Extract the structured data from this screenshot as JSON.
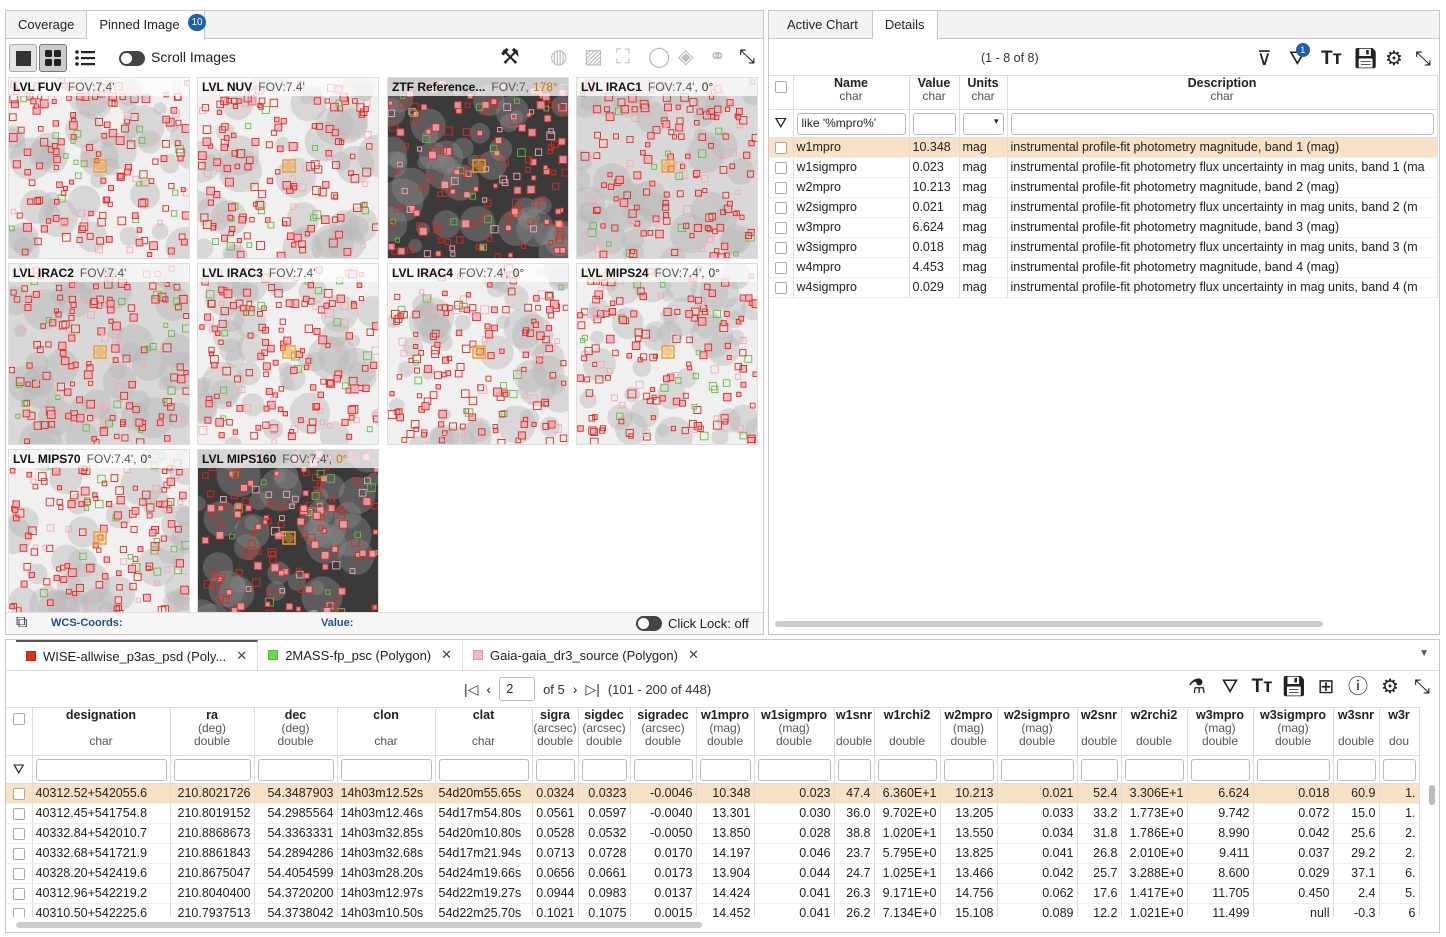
{
  "left_panel": {
    "tabs": [
      {
        "label": "Coverage"
      },
      {
        "label": "Pinned Image",
        "badge": "10"
      }
    ],
    "scroll_label": "Scroll Images",
    "tiles": [
      {
        "name": "LVL FUV",
        "fov": "FOV:7.4'",
        "rot": "",
        "bg": "light"
      },
      {
        "name": "LVL NUV",
        "fov": "FOV:7.4'",
        "rot": "",
        "bg": "light"
      },
      {
        "name": "ZTF Reference...",
        "fov": "FOV:7,",
        "rot": "178°",
        "bg": "dark"
      },
      {
        "name": "LVL IRAC1",
        "fov": "FOV:7.4',",
        "rot": "0°",
        "bg": "mid"
      },
      {
        "name": "LVL IRAC2",
        "fov": "FOV:7.4'",
        "rot": "",
        "bg": "mid"
      },
      {
        "name": "LVL IRAC3",
        "fov": "FOV:7.4'",
        "rot": "",
        "bg": "light"
      },
      {
        "name": "LVL IRAC4",
        "fov": "FOV:7.4',",
        "rot": "0°",
        "bg": "light"
      },
      {
        "name": "LVL MIPS24",
        "fov": "FOV:7.4',",
        "rot": "0°",
        "bg": "light"
      },
      {
        "name": "LVL MIPS70",
        "fov": "FOV:7.4',",
        "rot": "0°",
        "bg": "light"
      },
      {
        "name": "LVL MIPS160",
        "fov": "FOV:7.4',",
        "rot": "0°",
        "bg": "dark"
      }
    ],
    "status": {
      "wcs_label": "WCS-Coords:",
      "value_label": "Value:",
      "click_lock": "Click Lock: off"
    }
  },
  "right_panel": {
    "tabs": [
      {
        "label": "Active Chart"
      },
      {
        "label": "Details"
      }
    ],
    "count": "(1 - 8 of 8)",
    "filter_badge": "1",
    "columns": [
      {
        "name": "Name",
        "type": "char",
        "filter": "like '%mpro%'"
      },
      {
        "name": "Value",
        "type": "char",
        "filter": ""
      },
      {
        "name": "Units",
        "type": "char",
        "filter": ""
      },
      {
        "name": "Description",
        "type": "char",
        "filter": ""
      }
    ],
    "rows": [
      {
        "name": "w1mpro",
        "value": "10.348",
        "units": "mag",
        "desc": "instrumental profile-fit photometry magnitude, band 1 (mag)"
      },
      {
        "name": "w1sigmpro",
        "value": "0.023",
        "units": "mag",
        "desc": "instrumental profile-fit photometry flux uncertainty in mag units, band 1 (ma"
      },
      {
        "name": "w2mpro",
        "value": "10.213",
        "units": "mag",
        "desc": "instrumental profile-fit photometry magnitude, band 2 (mag)"
      },
      {
        "name": "w2sigmpro",
        "value": "0.021",
        "units": "mag",
        "desc": "instrumental profile-fit photometry flux uncertainty in mag units, band 2 (m"
      },
      {
        "name": "w3mpro",
        "value": "6.624",
        "units": "mag",
        "desc": "instrumental profile-fit photometry magnitude, band 3 (mag)"
      },
      {
        "name": "w3sigmpro",
        "value": "0.018",
        "units": "mag",
        "desc": "instrumental profile-fit photometry flux uncertainty in mag units, band 3 (m"
      },
      {
        "name": "w4mpro",
        "value": "4.453",
        "units": "mag",
        "desc": "instrumental profile-fit photometry magnitude, band 4 (mag)"
      },
      {
        "name": "w4sigmpro",
        "value": "0.029",
        "units": "mag",
        "desc": "instrumental profile-fit photometry flux uncertainty in mag units, band 4 (m"
      }
    ]
  },
  "bottom_panel": {
    "tabs": [
      {
        "label": "WISE-allwise_p3as_psd (Poly...",
        "color": "#e03020"
      },
      {
        "label": "2MASS-fp_psc (Polygon)",
        "color": "#66dd44"
      },
      {
        "label": "Gaia-gaia_dr3_source (Polygon)",
        "color": "#f4b8c4"
      }
    ],
    "pager": {
      "page": "2",
      "of": "of 5",
      "range": "(101 - 200 of 448)"
    },
    "columns": [
      {
        "name": "designation",
        "unit": "",
        "type": "char"
      },
      {
        "name": "ra",
        "unit": "(deg)",
        "type": "double"
      },
      {
        "name": "dec",
        "unit": "(deg)",
        "type": "double"
      },
      {
        "name": "clon",
        "unit": "",
        "type": "char"
      },
      {
        "name": "clat",
        "unit": "",
        "type": "char"
      },
      {
        "name": "sigra",
        "unit": "(arcsec)",
        "type": "double"
      },
      {
        "name": "sigdec",
        "unit": "(arcsec)",
        "type": "double"
      },
      {
        "name": "sigradec",
        "unit": "(arcsec)",
        "type": "double"
      },
      {
        "name": "w1mpro",
        "unit": "(mag)",
        "type": "double"
      },
      {
        "name": "w1sigmpro",
        "unit": "(mag)",
        "type": "double"
      },
      {
        "name": "w1snr",
        "unit": "",
        "type": "double"
      },
      {
        "name": "w1rchi2",
        "unit": "",
        "type": "double"
      },
      {
        "name": "w2mpro",
        "unit": "(mag)",
        "type": "double"
      },
      {
        "name": "w2sigmpro",
        "unit": "(mag)",
        "type": "double"
      },
      {
        "name": "w2snr",
        "unit": "",
        "type": "double"
      },
      {
        "name": "w2rchi2",
        "unit": "",
        "type": "double"
      },
      {
        "name": "w3mpro",
        "unit": "(mag)",
        "type": "double"
      },
      {
        "name": "w3sigmpro",
        "unit": "(mag)",
        "type": "double"
      },
      {
        "name": "w3snr",
        "unit": "",
        "type": "double"
      },
      {
        "name": "w3r",
        "unit": "",
        "type": "dou"
      }
    ],
    "rows": [
      [
        "40312.52+542055.6",
        "210.8021726",
        "54.3487903",
        "14h03m12.52s",
        "54d20m55.65s",
        "0.0324",
        "0.0323",
        "-0.0046",
        "10.348",
        "0.023",
        "47.4",
        "6.360E+1",
        "10.213",
        "0.021",
        "52.4",
        "3.306E+1",
        "6.624",
        "0.018",
        "60.9",
        "1."
      ],
      [
        "40312.45+541754.8",
        "210.8019152",
        "54.2985564",
        "14h03m12.46s",
        "54d17m54.80s",
        "0.0561",
        "0.0597",
        "-0.0040",
        "13.301",
        "0.030",
        "36.0",
        "9.702E+0",
        "13.205",
        "0.033",
        "33.2",
        "1.773E+0",
        "9.742",
        "0.072",
        "15.0",
        "1."
      ],
      [
        "40332.84+542010.7",
        "210.8868673",
        "54.3363331",
        "14h03m32.85s",
        "54d20m10.80s",
        "0.0528",
        "0.0532",
        "-0.0050",
        "13.850",
        "0.028",
        "38.8",
        "1.020E+1",
        "13.550",
        "0.034",
        "31.8",
        "1.786E+0",
        "8.990",
        "0.042",
        "25.6",
        "2."
      ],
      [
        "40332.68+541721.9",
        "210.8861843",
        "54.2894286",
        "14h03m32.68s",
        "54d17m21.94s",
        "0.0713",
        "0.0728",
        "0.0170",
        "14.197",
        "0.046",
        "23.7",
        "5.795E+0",
        "13.825",
        "0.041",
        "26.8",
        "2.010E+0",
        "9.411",
        "0.037",
        "29.2",
        "2."
      ],
      [
        "40328.20+542419.6",
        "210.8675047",
        "54.4054599",
        "14h03m28.20s",
        "54d24m19.66s",
        "0.0656",
        "0.0661",
        "0.0173",
        "13.904",
        "0.044",
        "24.7",
        "1.025E+1",
        "13.466",
        "0.042",
        "25.7",
        "3.288E+0",
        "8.600",
        "0.029",
        "37.1",
        "6."
      ],
      [
        "40312.96+542219.2",
        "210.8040400",
        "54.3720200",
        "14h03m12.97s",
        "54d22m19.27s",
        "0.0944",
        "0.0983",
        "0.0137",
        "14.424",
        "0.041",
        "26.3",
        "9.171E+0",
        "14.756",
        "0.062",
        "17.6",
        "1.417E+0",
        "11.705",
        "0.450",
        "2.4",
        "5."
      ],
      [
        "40310.50+542225.6",
        "210.7937513",
        "54.3738042",
        "14h03m10.50s",
        "54d22m25.70s",
        "0.1021",
        "0.1075",
        "0.0015",
        "14.452",
        "0.041",
        "26.2",
        "7.134E+0",
        "15.108",
        "0.089",
        "12.2",
        "1.021E+0",
        "11.499",
        "null",
        "-0.3",
        "6"
      ]
    ]
  }
}
